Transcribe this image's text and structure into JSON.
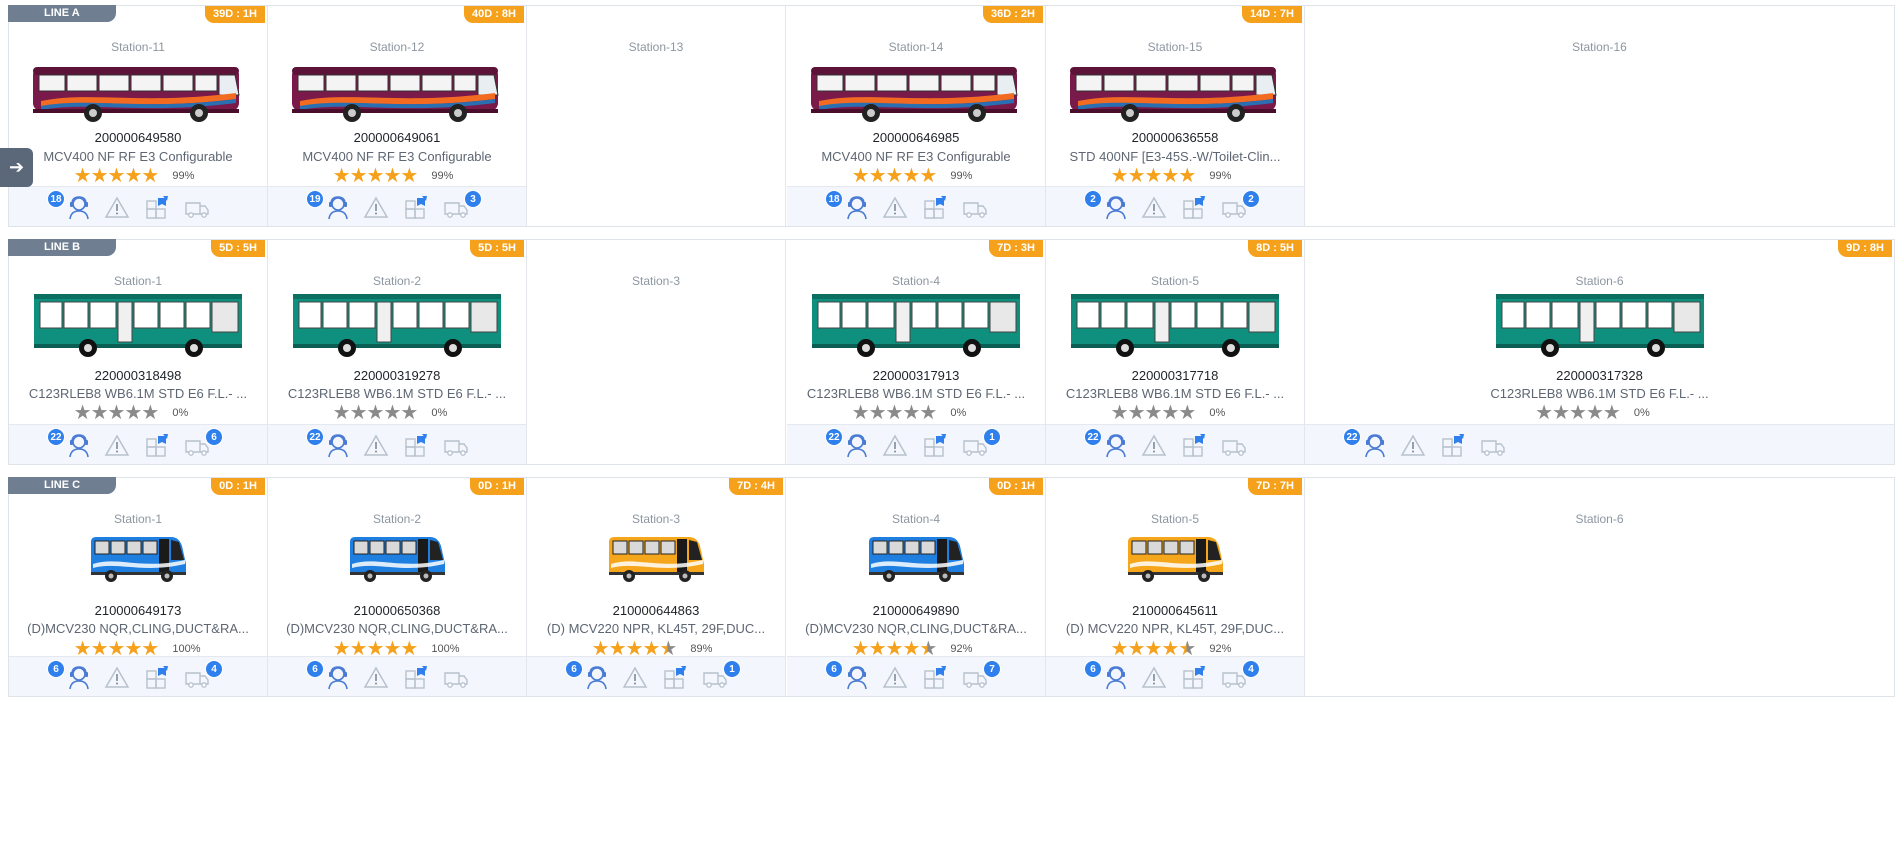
{
  "lines": [
    {
      "label": "LINE A",
      "bus_style": "coach",
      "cells": [
        {
          "station": "Station-11",
          "timer": "39D : 1H",
          "vin": "200000649580",
          "model": "MCV400 NF RF E3 Configurable",
          "stars": 5,
          "pct": "99%",
          "person_count": "18",
          "van_count": ""
        },
        {
          "station": "Station-12",
          "timer": "40D : 8H",
          "vin": "200000649061",
          "model": "MCV400 NF RF E3 Configurable",
          "stars": 5,
          "pct": "99%",
          "person_count": "19",
          "van_count": "3"
        },
        {
          "station": "Station-13"
        },
        {
          "station": "Station-14",
          "timer": "36D : 2H",
          "vin": "200000646985",
          "model": "MCV400 NF RF E3 Configurable",
          "stars": 5,
          "pct": "99%",
          "person_count": "18",
          "van_count": ""
        },
        {
          "station": "Station-15",
          "timer": "14D : 7H",
          "vin": "200000636558",
          "model": "STD 400NF [E3-45S.-W/Toilet-Clin...",
          "stars": 5,
          "pct": "99%",
          "person_count": "2",
          "van_count": "2"
        },
        {
          "station": "Station-16"
        }
      ]
    },
    {
      "label": "LINE B",
      "bus_style": "city",
      "cells": [
        {
          "station": "Station-1",
          "timer": "5D : 5H",
          "vin": "220000318498",
          "model": "C123RLEB8 WB6.1M STD E6 F.L.- ...",
          "stars": 0,
          "pct": "0%",
          "person_count": "22",
          "van_count": "6"
        },
        {
          "station": "Station-2",
          "timer": "5D : 5H",
          "vin": "220000319278",
          "model": "C123RLEB8 WB6.1M STD E6 F.L.- ...",
          "stars": 0,
          "pct": "0%",
          "person_count": "22",
          "van_count": ""
        },
        {
          "station": "Station-3"
        },
        {
          "station": "Station-4",
          "timer": "7D : 3H",
          "vin": "220000317913",
          "model": "C123RLEB8 WB6.1M STD E6 F.L.- ...",
          "stars": 0,
          "pct": "0%",
          "person_count": "22",
          "van_count": "1"
        },
        {
          "station": "Station-5",
          "timer": "8D : 5H",
          "vin": "220000317718",
          "model": "C123RLEB8 WB6.1M STD E6 F.L.- ...",
          "stars": 0,
          "pct": "0%",
          "person_count": "22",
          "van_count": ""
        },
        {
          "station": "Station-6",
          "timer": "9D : 8H",
          "vin": "220000317328",
          "model": "C123RLEB8 WB6.1M STD E6 F.L.- ...",
          "stars": 0,
          "pct": "0%",
          "person_count": "22",
          "van_count": ""
        }
      ]
    },
    {
      "label": "LINE C",
      "bus_style": "mini",
      "cells": [
        {
          "station": "Station-1",
          "timer": "0D : 1H",
          "vin": "210000649173",
          "model": "(D)MCV230 NQR,CLING,DUCT&RA...",
          "stars": 5,
          "pct": "100%",
          "person_count": "6",
          "van_count": "4",
          "color": "blue"
        },
        {
          "station": "Station-2",
          "timer": "0D : 1H",
          "vin": "210000650368",
          "model": "(D)MCV230 NQR,CLING,DUCT&RA...",
          "stars": 5,
          "pct": "100%",
          "person_count": "6",
          "van_count": "",
          "color": "blue"
        },
        {
          "station": "Station-3",
          "timer": "7D : 4H",
          "vin": "210000644863",
          "model": "(D) MCV220 NPR, KL45T, 29F,DUC...",
          "stars": 4.5,
          "pct": "89%",
          "person_count": "6",
          "van_count": "1",
          "color": "yellow"
        },
        {
          "station": "Station-4",
          "timer": "0D : 1H",
          "vin": "210000649890",
          "model": "(D)MCV230 NQR,CLING,DUCT&RA...",
          "stars": 4.5,
          "pct": "92%",
          "person_count": "6",
          "van_count": "7",
          "color": "blue"
        },
        {
          "station": "Station-5",
          "timer": "7D : 7H",
          "vin": "210000645611",
          "model": "(D) MCV220 NPR, KL45T, 29F,DUC...",
          "stars": 4.5,
          "pct": "92%",
          "person_count": "6",
          "van_count": "4",
          "color": "yellow"
        },
        {
          "station": "Station-6"
        }
      ]
    }
  ],
  "side_toggle_icon": "arrow-right-icon",
  "colors": {
    "timer": "#f5a11b",
    "badge": "#2f80ed",
    "line_tag": "#6f7f91",
    "coach": "#7a1a4a",
    "city": "#0f8f7e",
    "mini_blue": "#1e7fe0",
    "mini_yellow": "#f5a61a"
  }
}
